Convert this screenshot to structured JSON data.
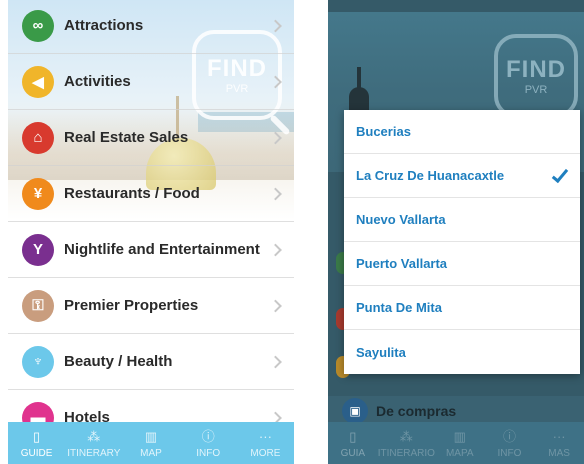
{
  "left": {
    "logo": {
      "top": "FIND",
      "bottom": "PVR"
    },
    "items": [
      {
        "label": "Attractions",
        "icon": "binoculars-icon",
        "color": "#3a9a48"
      },
      {
        "label": "Activities",
        "icon": "megaphone-icon",
        "color": "#f0b52a"
      },
      {
        "label": "Real Estate Sales",
        "icon": "house-icon",
        "color": "#d83a2e"
      },
      {
        "label": "Restaurants / Food",
        "icon": "fork-knife-icon",
        "color": "#f08a1c"
      },
      {
        "label": "Nightlife and Entertainment",
        "icon": "cocktail-icon",
        "color": "#7a2f8f"
      },
      {
        "label": "Premier Properties",
        "icon": "key-icon",
        "color": "#c99d7e"
      },
      {
        "label": "Beauty / Health",
        "icon": "spa-icon",
        "color": "#6cc8ea"
      },
      {
        "label": "Hotels",
        "icon": "bed-icon",
        "color": "#e0338e"
      }
    ],
    "tabs": [
      {
        "label": "GUIDE",
        "icon": "book-icon",
        "active": true
      },
      {
        "label": "ITINERARY",
        "icon": "footsteps-icon",
        "active": false
      },
      {
        "label": "MAP",
        "icon": "map-icon",
        "active": false
      },
      {
        "label": "INFO",
        "icon": "info-icon",
        "active": false
      },
      {
        "label": "MORE",
        "icon": "more-icon",
        "active": false
      }
    ]
  },
  "right": {
    "logo": {
      "top": "FIND",
      "bottom": "PVR"
    },
    "dropdown": {
      "options": [
        {
          "label": "Bucerias",
          "selected": false
        },
        {
          "label": "La Cruz De Huanacaxtle",
          "selected": true
        },
        {
          "label": "Nuevo Vallarta",
          "selected": false
        },
        {
          "label": "Puerto Vallarta",
          "selected": false
        },
        {
          "label": "Punta De Mita",
          "selected": false
        },
        {
          "label": "Sayulita",
          "selected": false
        }
      ]
    },
    "bottom_item": {
      "label": "De compras",
      "icon": "shopping-bag-icon"
    },
    "tabs": [
      {
        "label": "GUIA",
        "icon": "book-icon",
        "active": true
      },
      {
        "label": "ITINERARIO",
        "icon": "footsteps-icon",
        "active": false
      },
      {
        "label": "MAPA",
        "icon": "map-icon",
        "active": false
      },
      {
        "label": "INFO",
        "icon": "info-icon",
        "active": false
      },
      {
        "label": "MAS",
        "icon": "more-icon",
        "active": false
      }
    ],
    "accent": "#1f7fbf"
  }
}
